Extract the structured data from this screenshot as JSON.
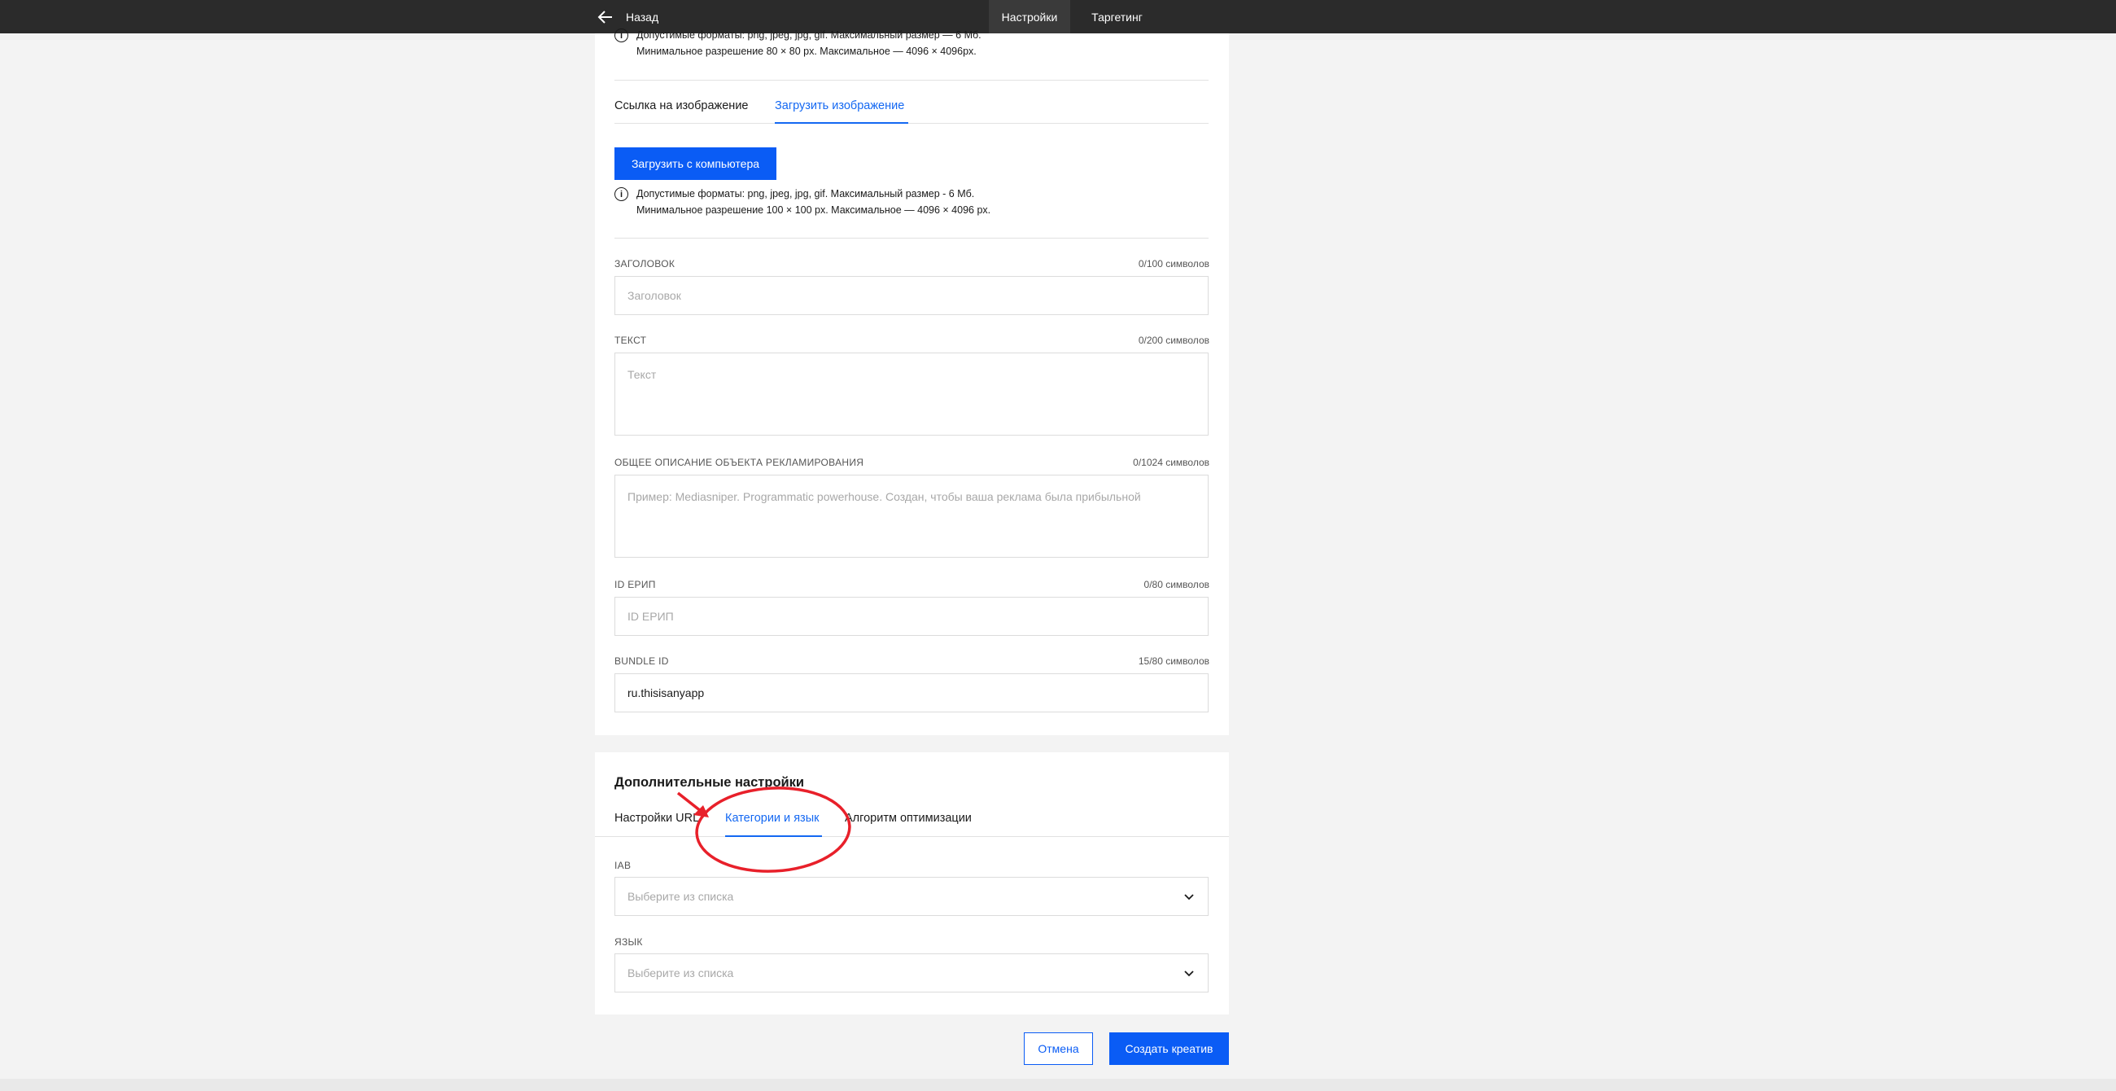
{
  "topbar": {
    "back_label": "Назад",
    "tabs": [
      {
        "label": "Настройки",
        "active": true
      },
      {
        "label": "Таргетинг",
        "active": false
      }
    ]
  },
  "logo_info": {
    "line1": "Допустимые форматы: png, jpeg, jpg, gif. Максимальный размер — 6 Мб.",
    "line2": "Минимальное разрешение 80 × 80 px. Максимальное — 4096 × 4096px."
  },
  "image_tabs": [
    {
      "label": "Ссылка на изображение",
      "active": false
    },
    {
      "label": "Загрузить изображение",
      "active": true
    }
  ],
  "upload": {
    "button_label": "Загрузить с компьютера",
    "info_line1": "Допустимые форматы: png, jpeg, jpg, gif. Максимальный размер - 6 Мб.",
    "info_line2": "Минимальное разрешение 100 × 100 px. Максимальное — 4096 × 4096 px."
  },
  "fields": {
    "title": {
      "label": "ЗАГОЛОВОК",
      "counter": "0/100 символов",
      "placeholder": "Заголовок",
      "value": ""
    },
    "text": {
      "label": "ТЕКСТ",
      "counter": "0/200 символов",
      "placeholder": "Текст",
      "value": ""
    },
    "description": {
      "label": "ОБЩЕЕ ОПИСАНИЕ ОБЪЕКТА РЕКЛАМИРОВАНИЯ",
      "counter": "0/1024 символов",
      "placeholder": "Пример: Mediasniper. Programmatic powerhouse. Создан, чтобы ваша реклама была прибыльной",
      "value": ""
    },
    "erip": {
      "label": "ID ЕРИП",
      "counter": "0/80 символов",
      "placeholder": "ID ЕРИП",
      "value": ""
    },
    "bundle": {
      "label": "BUNDLE ID",
      "counter": "15/80 символов",
      "placeholder": "",
      "value": "ru.thisisanyapp"
    }
  },
  "additional": {
    "title": "Дополнительные настройки",
    "tabs": [
      {
        "label": "Настройки URL",
        "active": false
      },
      {
        "label": "Категории и язык",
        "active": true
      },
      {
        "label": "Алгоритм оптимизации",
        "active": false
      }
    ],
    "iab": {
      "label": "IAB",
      "placeholder": "Выберите из списка"
    },
    "language": {
      "label": "ЯЗЫК",
      "placeholder": "Выберите из списка"
    }
  },
  "actions": {
    "cancel_label": "Отмена",
    "create_label": "Создать креатив"
  },
  "colors": {
    "accent": "#0a5cf5",
    "active_tab": "#1468f2",
    "topbar": "#2b2b2b",
    "annotation": "#e8202a"
  }
}
